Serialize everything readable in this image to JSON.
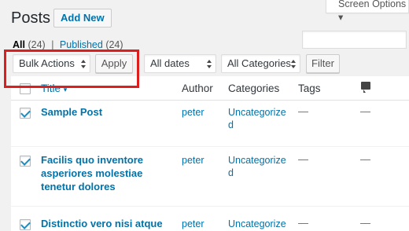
{
  "header": {
    "title": "Posts",
    "add_new": "Add New",
    "screen_options": "Screen Options ▾"
  },
  "views": {
    "all_label": "All",
    "all_count": "(24)",
    "sep": "|",
    "published_label": "Published",
    "published_count": "(24)"
  },
  "filters": {
    "bulk_actions": "Bulk Actions",
    "apply": "Apply",
    "dates": "All dates",
    "categories": "All Categories",
    "filter": "Filter"
  },
  "table": {
    "columns": {
      "title": "Title",
      "author": "Author",
      "categories": "Categories",
      "tags": "Tags"
    },
    "rows": [
      {
        "title_lines": [
          "Sample Post"
        ],
        "author": "peter",
        "category_lines": [
          "Uncategorize",
          "d"
        ],
        "tags": "—",
        "comments": "—"
      },
      {
        "title_lines": [
          "Facilis quo inventore",
          "asperiores molestiae",
          "tenetur dolores"
        ],
        "author": "peter",
        "category_lines": [
          "Uncategorize",
          "d"
        ],
        "tags": "—",
        "comments": "—"
      },
      {
        "title_lines": [
          "Distinctio vero nisi atque"
        ],
        "author": "peter",
        "category_lines": [
          "Uncategorize"
        ],
        "tags": "—",
        "comments": "—"
      }
    ]
  },
  "colors": {
    "link": "#0073aa",
    "highlight": "#dd1e1e"
  }
}
